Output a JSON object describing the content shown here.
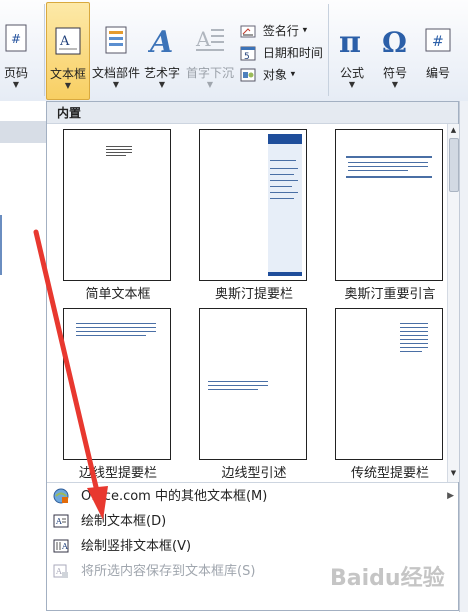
{
  "ribbon": {
    "page_number_label": "页码",
    "textbox_label": "文本框",
    "quickparts_label": "文档部件",
    "wordart_label": "艺术字",
    "dropcap_label": "首字下沉",
    "signature_label": "签名行",
    "datetime_label": "日期和时间",
    "object_label": "对象",
    "equation_label": "公式",
    "symbol_label": "符号",
    "number_label": "编号",
    "dropdown_arrow": "▼",
    "small_arrow": "▾"
  },
  "dropdown": {
    "section_header": "内置",
    "gallery": [
      {
        "label": "简单文本框"
      },
      {
        "label": "奥斯汀提要栏"
      },
      {
        "label": "奥斯汀重要引言"
      },
      {
        "label": "边线型提要栏"
      },
      {
        "label": "边线型引述"
      },
      {
        "label": "传统型提要栏"
      }
    ],
    "menu": [
      {
        "text": "Office.com 中的其他文本框(M)",
        "icon": "office-globe-icon",
        "has_submenu": true,
        "submenu_glyph": "▶"
      },
      {
        "text": "绘制文本框(D)",
        "icon": "draw-textbox-icon"
      },
      {
        "text": "绘制竖排文本框(V)",
        "icon": "draw-vertical-textbox-icon"
      },
      {
        "text": "将所选内容保存到文本框库(S)",
        "icon": "save-selection-icon",
        "disabled": true
      }
    ],
    "scroll_up": "▲",
    "scroll_down": "▼"
  },
  "watermark": "Baidu经验",
  "colors": {
    "arrow": "#e8382f",
    "active_button": "#f8cf63",
    "accent_blue": "#1f4e9b"
  }
}
